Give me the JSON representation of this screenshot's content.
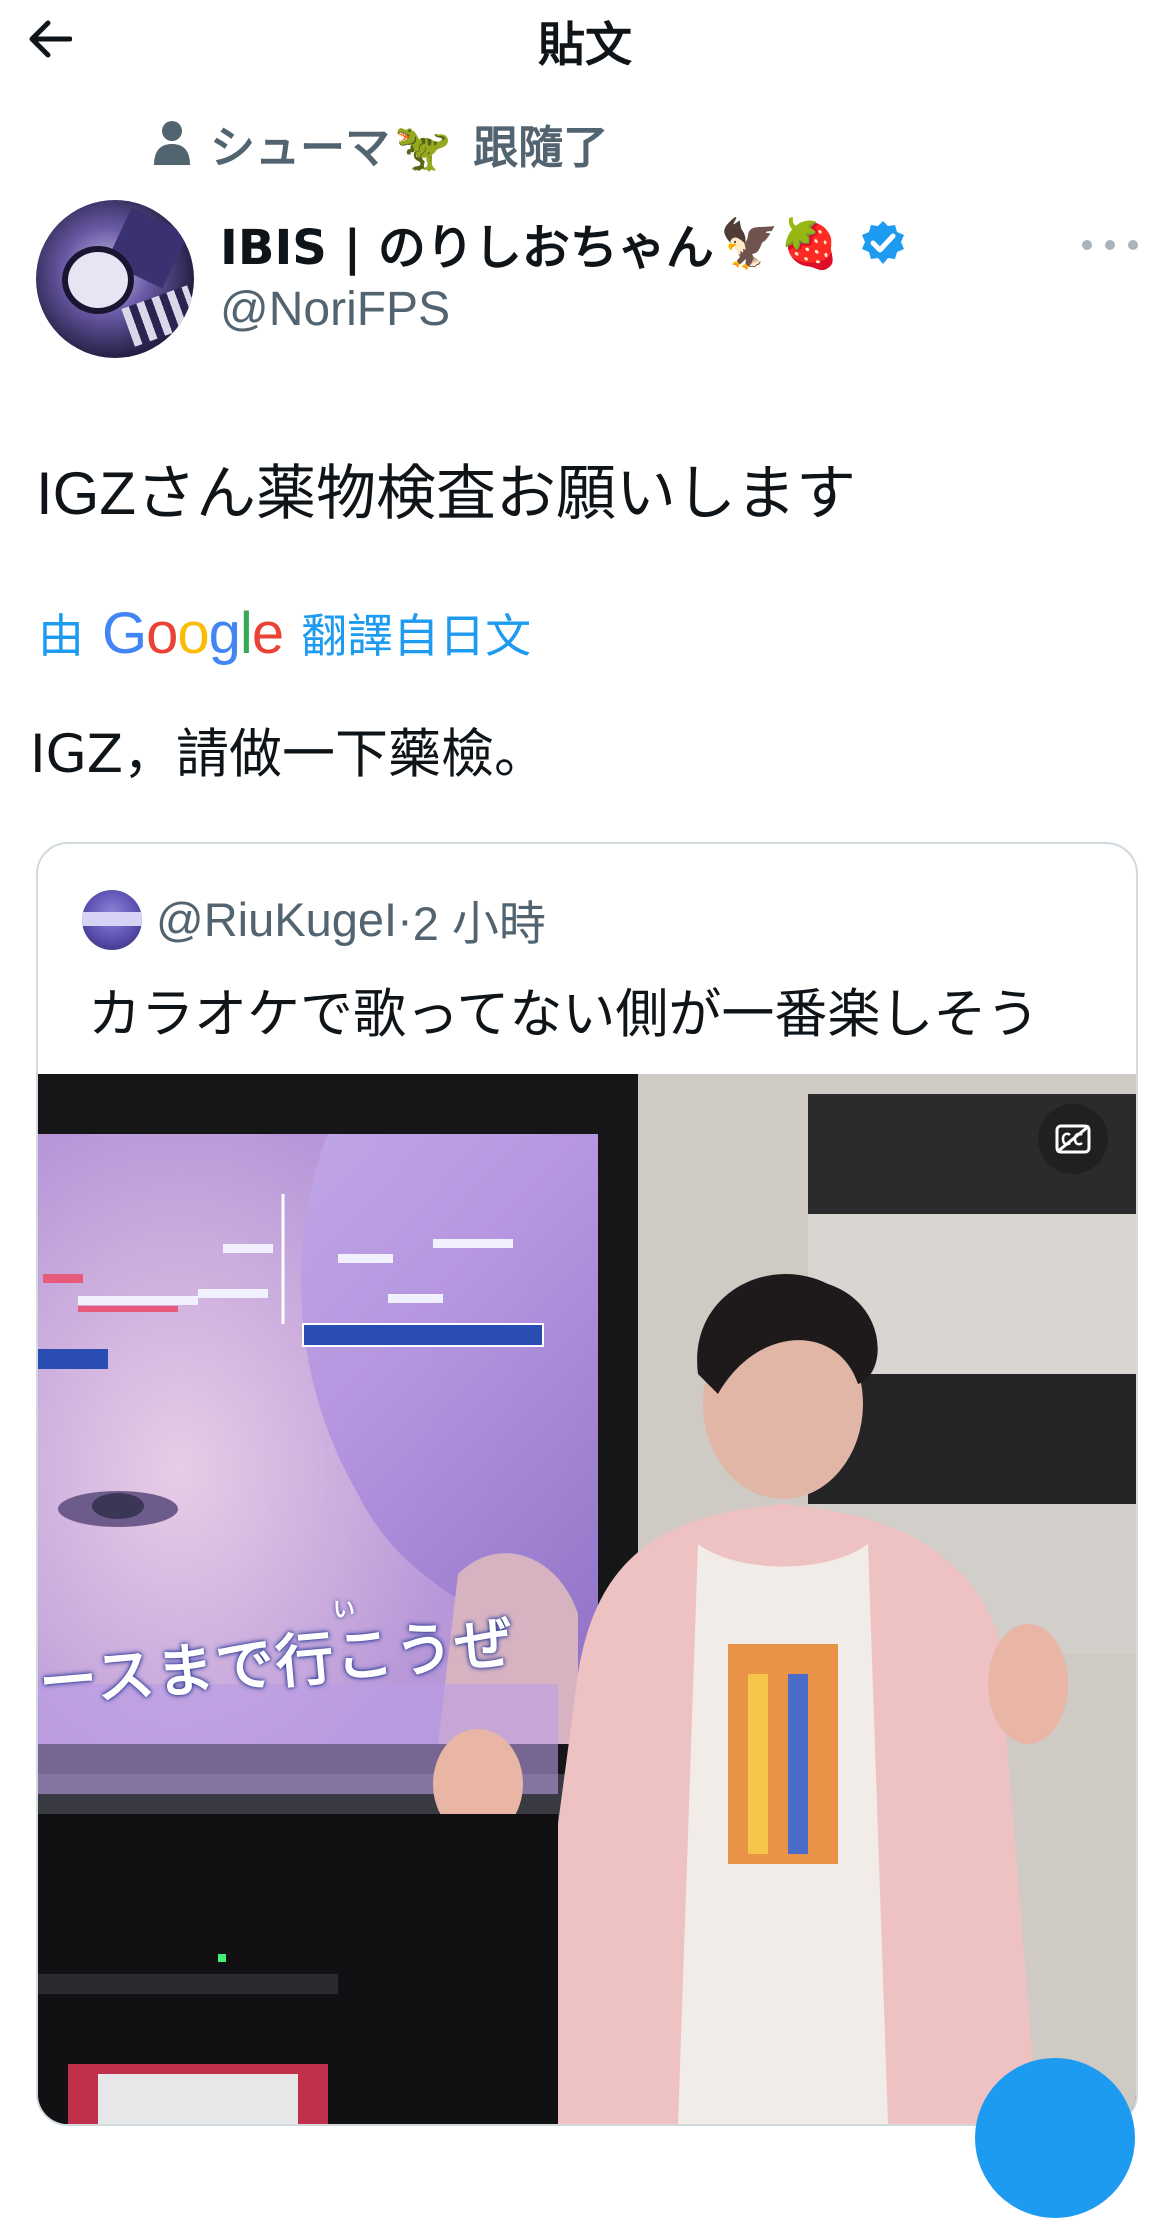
{
  "header": {
    "title": "貼文"
  },
  "retweet": {
    "user": "シューマ",
    "emoji": "🦖",
    "suffix": "跟隨了"
  },
  "author": {
    "name": "IBIS | のりしおちゃん",
    "name_emojis": "🦅🍓",
    "handle": "@NoriFPS"
  },
  "tweet": {
    "text": "IGZさん薬物検査お願いします",
    "translate_prefix": "由",
    "translate_brand": "Google",
    "translate_suffix": "翻譯自日文",
    "translated_text": "IGZ，請做一下藥檢。"
  },
  "quote": {
    "handle": "@RiuKugeI",
    "separator": "·",
    "time": "2 小時",
    "text": "カラオケで歌ってない側が一番楽しそう",
    "video_caption": "ースまで行こうぜ",
    "video_caption_ruby": "い"
  },
  "colors": {
    "accent": "#1d9bf0",
    "muted": "#536471",
    "border": "#cfd9de"
  },
  "icons": {
    "back": "arrow-left-icon",
    "retweet_person": "person-icon",
    "verified": "verified-badge-icon",
    "more": "more-dots-icon",
    "captions": "captions-icon"
  }
}
